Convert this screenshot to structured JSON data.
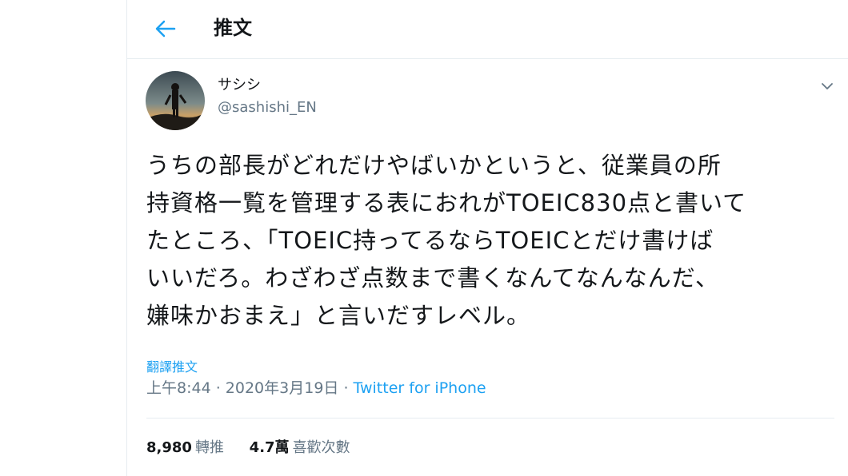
{
  "header": {
    "title": "推文",
    "back_icon": "arrow-left-icon"
  },
  "colors": {
    "accent": "#1da1f2",
    "text_primary": "#14171a",
    "text_secondary": "#657786",
    "divider": "#e6ecf0"
  },
  "tweet": {
    "author": {
      "display_name": "サシシ",
      "handle": "@sashishi_EN"
    },
    "text": "うちの部長がどれだけやばいかというと、従業員の所\n持資格一覧を管理する表におれがTOEIC830点と書いて\nたところ、「TOEIC持ってるならTOEICとだけ書けば\nいいだろ。わざわざ点数まで書くなんてなんなんだ、\n嫌味かおまえ」と言いだすレベル。",
    "translate_label": "翻譯推文",
    "time": "上午8:44 · 2020年3月19日",
    "separator": " · ",
    "source": "Twitter for iPhone",
    "menu_icon": "chevron-down-icon"
  },
  "stats": {
    "retweets": {
      "count": "8,980",
      "label": "轉推"
    },
    "likes": {
      "count": "4.7萬",
      "label": "喜歡次數"
    }
  }
}
